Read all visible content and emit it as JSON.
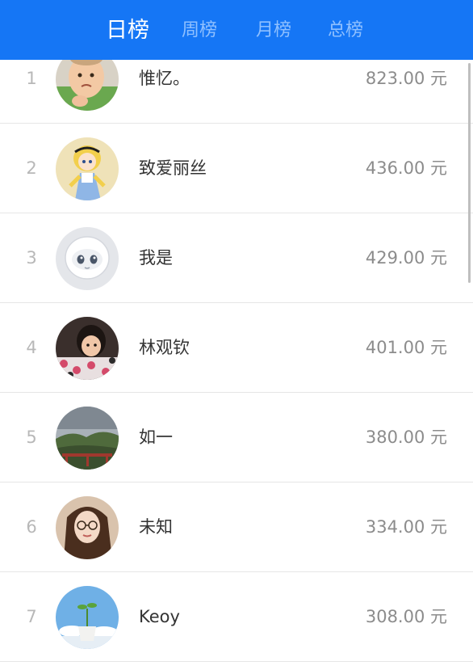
{
  "tabs": {
    "daily": "日榜",
    "weekly": "周榜",
    "monthly": "月榜",
    "total": "总榜"
  },
  "colors": {
    "header_bg": "#1576f5",
    "tab_active": "#ffffff",
    "tab_inactive": "#8fc0ff"
  },
  "ranking": [
    {
      "rank": "1",
      "name": "惟忆。",
      "amount": "823.00 元",
      "avatar_icon": "baby-avatar"
    },
    {
      "rank": "2",
      "name": "致爱丽丝",
      "amount": "436.00 元",
      "avatar_icon": "alice-avatar"
    },
    {
      "rank": "3",
      "name": "我是",
      "amount": "429.00 元",
      "avatar_icon": "robot-avatar"
    },
    {
      "rank": "4",
      "name": "林观钦",
      "amount": "401.00 元",
      "avatar_icon": "girl-avatar"
    },
    {
      "rank": "5",
      "name": "如一",
      "amount": "380.00 元",
      "avatar_icon": "landscape-avatar"
    },
    {
      "rank": "6",
      "name": "未知",
      "amount": "334.00 元",
      "avatar_icon": "woman-avatar"
    },
    {
      "rank": "7",
      "name": "Keoy",
      "amount": "308.00 元",
      "avatar_icon": "sprout-avatar"
    }
  ]
}
